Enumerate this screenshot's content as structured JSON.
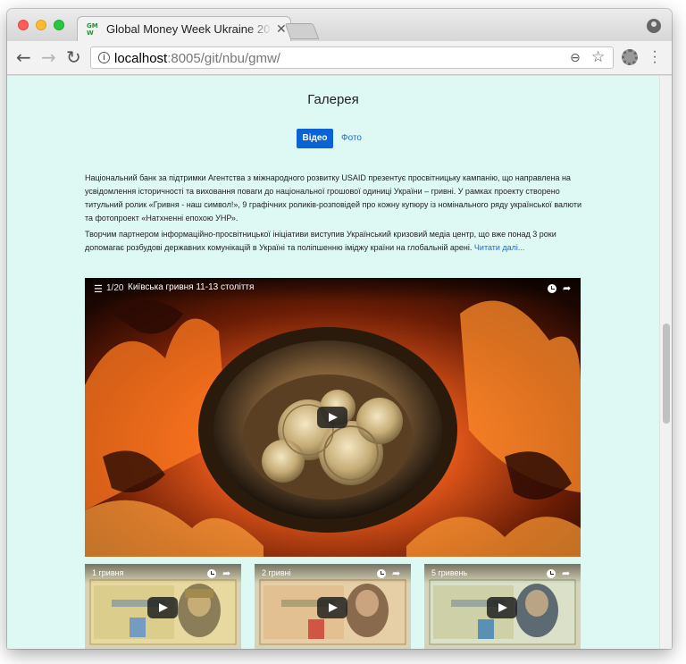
{
  "browser": {
    "tab_title": "Global Money Week Ukraine 20",
    "tab_favicon": "GM W",
    "tab_close": "✕",
    "url_host": "localhost",
    "url_path": ":8005/git/nbu/gmw/",
    "icons": [
      "back-arrow-icon",
      "forward-arrow-icon",
      "reload-icon",
      "info-icon",
      "zoom-icon",
      "star-icon",
      "extension-icon",
      "menu-icon",
      "profile-icon"
    ]
  },
  "page": {
    "gallery_title": "Галерея",
    "tabs": {
      "video": "Відео",
      "photo": "Фото"
    },
    "paragraph1": "Національний банк за підтримки Агентства з міжнародного розвитку USAID презентує просвітницьку кампанію, що направлена на усвідомлення історичності та виховання поваги до національної грошової одиниці України – гривні. У рамках проекту створено титульний ролик «Гривня - наш символ!», 9 графічних роликів-розповідей про кожну купюру із номінального ряду української валюти та фотопроект «Натхненні епохою УНР».",
    "paragraph2": "Творчим партнером інформаційно-просвітницької ініціативи виступив Український кризовий медіа центр, що вже понад 3 роки допомагає розбудові державних комунікацій в Україні та поліпшенню іміджу країни на глобальній арені.",
    "read_more": "Читати далі...",
    "colors": {
      "background": "#def9f4",
      "accent": "#0a62d3",
      "link": "#1f6ad1"
    }
  },
  "main_video": {
    "playlist_count": "1/20",
    "title": "Київська гривня 11-13 століття"
  },
  "thumbnails": [
    {
      "title": "1 гривня"
    },
    {
      "title": "2 гривні"
    },
    {
      "title": "5 гривень"
    }
  ]
}
